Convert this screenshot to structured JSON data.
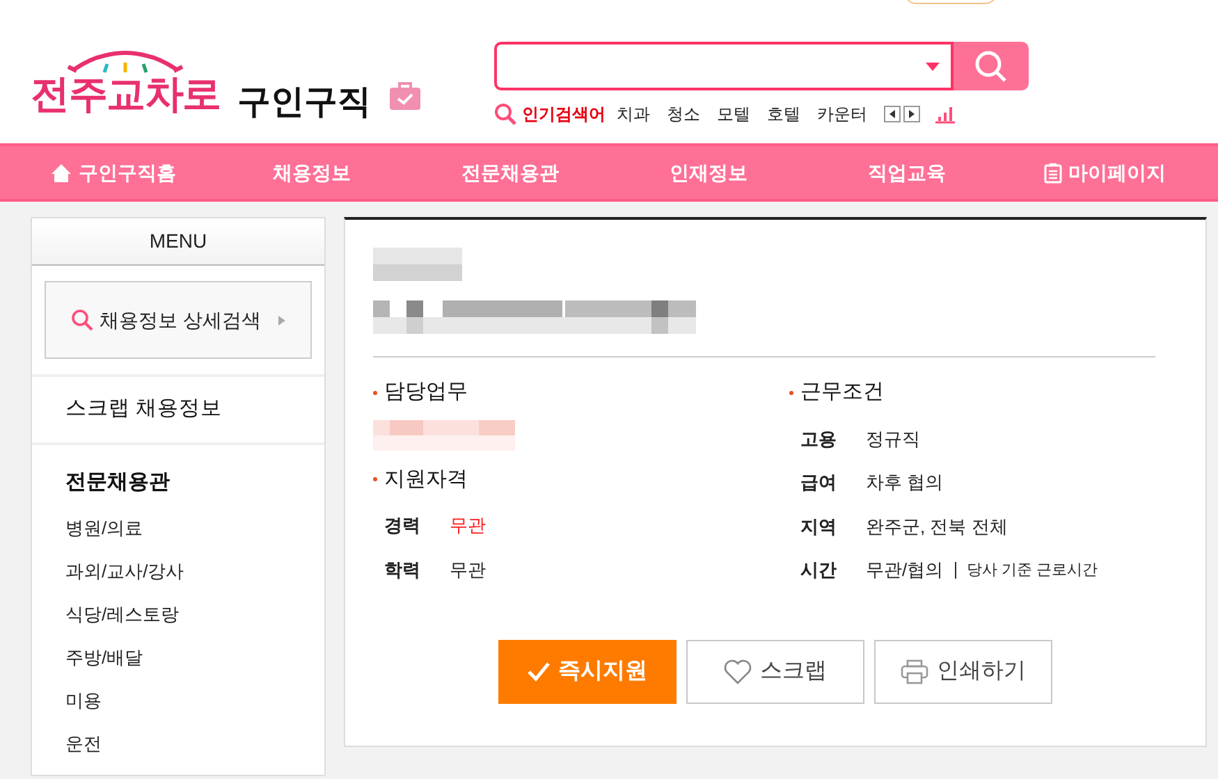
{
  "logo": {
    "text": "전주교차로",
    "subtitle": "구인구직"
  },
  "search": {
    "popular_label": "인기검색어",
    "keywords": [
      "치과",
      "청소",
      "모텔",
      "호텔",
      "카운터"
    ]
  },
  "nav": [
    {
      "label": "구인구직홈",
      "kind": "home"
    },
    {
      "label": "채용정보",
      "kind": "plain"
    },
    {
      "label": "전문채용관",
      "kind": "plain"
    },
    {
      "label": "인재정보",
      "kind": "plain"
    },
    {
      "label": "직업교육",
      "kind": "plain"
    },
    {
      "label": "마이페이지",
      "kind": "mypage"
    }
  ],
  "sidebar": {
    "title": "MENU",
    "detail_search": "채용정보 상세검색",
    "scrap": "스크랩 채용정보",
    "section": "전문채용관",
    "items": [
      "병원/의료",
      "과외/교사/강사",
      "식당/레스토랑",
      "주방/배달",
      "미용",
      "운전"
    ]
  },
  "job": {
    "duty_heading": "담당업무",
    "qualification_heading": "지원자격",
    "qualifications": [
      {
        "label": "경력",
        "value": "무관",
        "highlight": true
      },
      {
        "label": "학력",
        "value": "무관",
        "highlight": false
      }
    ],
    "conditions_heading": "근무조건",
    "conditions": [
      {
        "label": "고용",
        "value": "정규직"
      },
      {
        "label": "급여",
        "value": "차후 협의"
      },
      {
        "label": "지역",
        "value": "완주군, 전북 전체"
      },
      {
        "label": "시간",
        "value": "무관/협의",
        "note": "당사 기준 근로시간"
      }
    ]
  },
  "buttons": [
    {
      "kind": "apply",
      "label": "즉시지원"
    },
    {
      "kind": "scrap",
      "label": "스크랩"
    },
    {
      "kind": "print",
      "label": "인쇄하기"
    }
  ]
}
